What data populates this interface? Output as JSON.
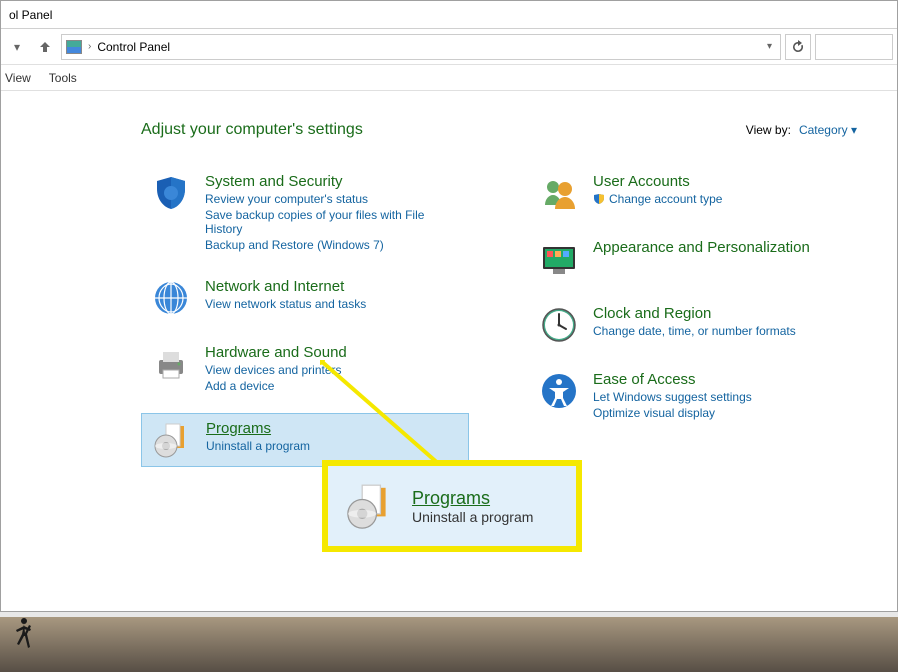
{
  "window": {
    "title_fragment": "ol Panel"
  },
  "addressbar": {
    "location": "Control Panel"
  },
  "menubar": {
    "view": "View",
    "tools": "Tools"
  },
  "content": {
    "heading": "Adjust your computer's settings",
    "viewby": {
      "label": "View by:",
      "value": "Category"
    },
    "left_categories": [
      {
        "title": "System and Security",
        "links": [
          "Review your computer's status",
          "Save backup copies of your files with File History",
          "Backup and Restore (Windows 7)"
        ]
      },
      {
        "title": "Network and Internet",
        "links": [
          "View network status and tasks"
        ]
      },
      {
        "title": "Hardware and Sound",
        "links": [
          "View devices and printers",
          "Add a device"
        ]
      },
      {
        "title": "Programs",
        "links": [
          "Uninstall a program"
        ]
      }
    ],
    "right_categories": [
      {
        "title": "User Accounts",
        "links": [
          "Change account type"
        ]
      },
      {
        "title": "Appearance and Personalization",
        "links": []
      },
      {
        "title": "Clock and Region",
        "links": [
          "Change date, time, or number formats"
        ]
      },
      {
        "title": "Ease of Access",
        "links": [
          "Let Windows suggest settings",
          "Optimize visual display"
        ]
      }
    ]
  },
  "callout": {
    "title": "Programs",
    "subtitle": "Uninstall a program"
  }
}
